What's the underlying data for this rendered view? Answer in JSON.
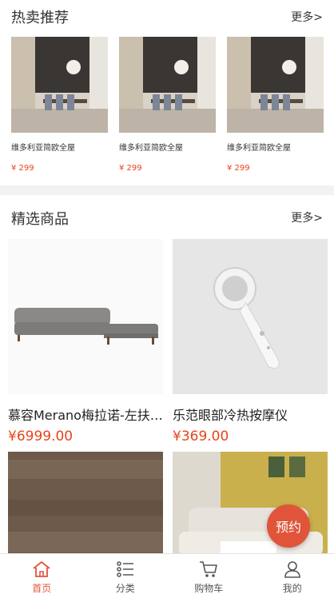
{
  "hot": {
    "title": "热卖推荐",
    "more": "更多>",
    "items": [
      {
        "name": "维多利亚简欧全屋",
        "price": "¥ 299"
      },
      {
        "name": "维多利亚简欧全屋",
        "price": "¥ 299"
      },
      {
        "name": "维多利亚简欧全屋",
        "price": "¥ 299"
      }
    ]
  },
  "featured": {
    "title": "精选商品",
    "more": "更多>",
    "items": [
      {
        "name": "慕容Merano梅拉诺-左扶手沙发",
        "price": "¥6999.00"
      },
      {
        "name": "乐范眼部冷热按摩仪",
        "price": "¥369.00"
      },
      {
        "name": "",
        "price": ""
      },
      {
        "name": "",
        "price": ""
      }
    ]
  },
  "reserve": {
    "label": "预约"
  },
  "tabbar": {
    "tabs": [
      {
        "label": "首页",
        "icon": "home-icon",
        "active": true
      },
      {
        "label": "分类",
        "icon": "category-icon",
        "active": false
      },
      {
        "label": "购物车",
        "icon": "cart-icon",
        "active": false
      },
      {
        "label": "我的",
        "icon": "user-icon",
        "active": false
      }
    ]
  },
  "colors": {
    "accent": "#e0553a",
    "price": "#e8441a"
  }
}
